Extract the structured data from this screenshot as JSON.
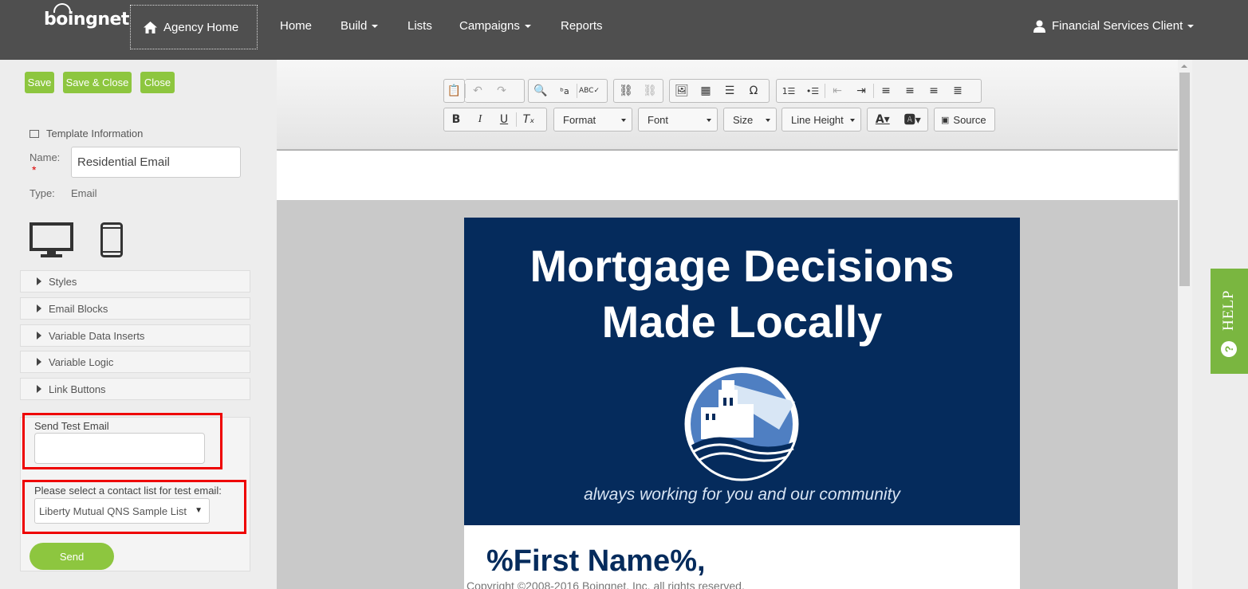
{
  "brand": {
    "logo": "boingnet"
  },
  "nav": {
    "agency_home": "Agency Home",
    "items": [
      {
        "label": "Home",
        "dropdown": false
      },
      {
        "label": "Build",
        "dropdown": true
      },
      {
        "label": "Lists",
        "dropdown": false
      },
      {
        "label": "Campaigns",
        "dropdown": true
      },
      {
        "label": "Reports",
        "dropdown": false
      }
    ],
    "user": "Financial Services Client"
  },
  "actions": {
    "save": "Save",
    "save_close": "Save & Close",
    "close": "Close"
  },
  "template_info": {
    "heading": "Template Information",
    "name_label": "Name:",
    "name_value": "Residential Email",
    "type_label": "Type:",
    "type_value": "Email"
  },
  "accordions": [
    "Styles",
    "Email Blocks",
    "Variable Data Inserts",
    "Variable Logic",
    "Link Buttons"
  ],
  "test_email": {
    "label": "Send Test Email",
    "value": "",
    "list_label": "Please select a contact list for test email:",
    "list_selected": "Liberty Mutual QNS Sample List",
    "send": "Send"
  },
  "toolbar": {
    "format": "Format",
    "font": "Font",
    "size": "Size",
    "line_height": "Line Height",
    "source": "Source",
    "bold": "B",
    "italic": "I",
    "underline": "U",
    "omega": "Ω"
  },
  "email": {
    "headline_line1": "Mortgage Decisions",
    "headline_line2": "Made Locally",
    "tagline": "always working for you and our community",
    "greeting": "%First Name%,",
    "copyright": "Copyright ©2008-2016 Boingnet, Inc. all rights reserved."
  },
  "help": {
    "label": "HELP"
  },
  "colors": {
    "accent_green": "#8dc63f",
    "nav_bg": "#4f4f4f",
    "banner_navy": "#052b5c"
  }
}
